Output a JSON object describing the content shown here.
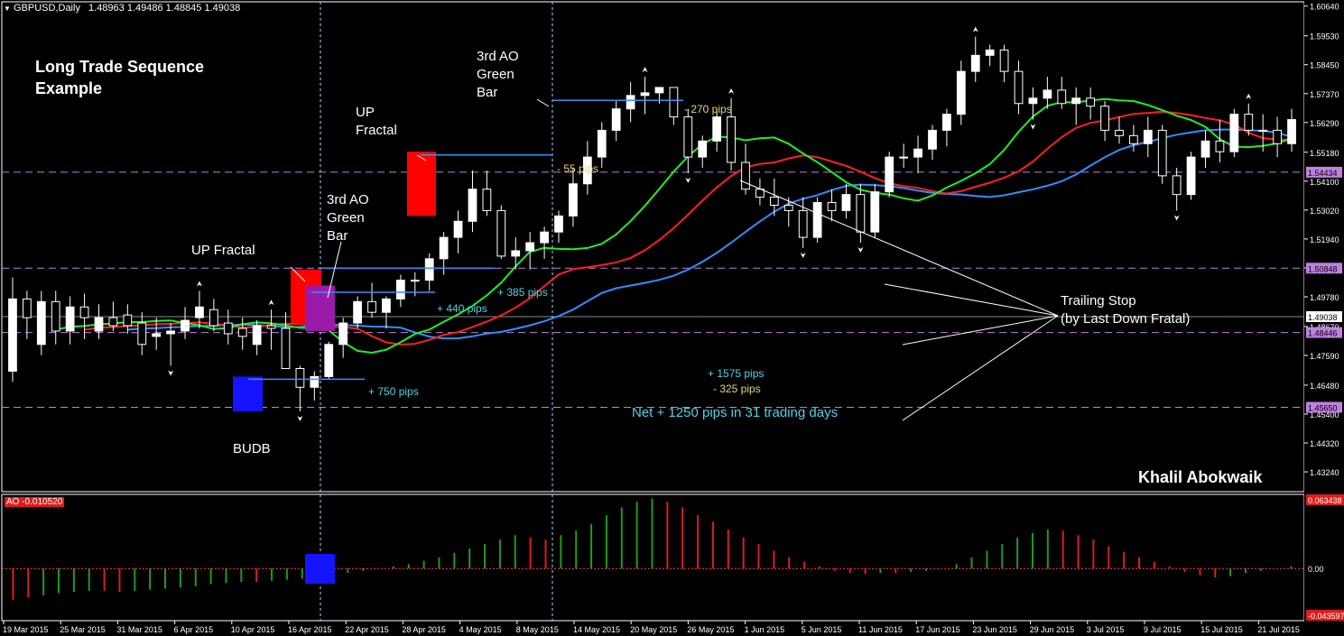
{
  "header": {
    "symbol": "GBPUSD,Daily",
    "ohlc": "1.48963 1.49486 1.48845 1.49038"
  },
  "annotations": {
    "title_line1": "Long Trade Sequence",
    "title_line2": "Example",
    "up_fractal_1": "UP Fractal",
    "ao_green_1_l1": "3rd AO",
    "ao_green_1_l2": "Green",
    "ao_green_1_l3": "Bar",
    "up_fractal_2_l1": "UP",
    "up_fractal_2_l2": "Fractal",
    "ao_green_2_l1": "3rd AO",
    "ao_green_2_l2": "Green",
    "ao_green_2_l3": "Bar",
    "budb": "BUDB",
    "trailing_l1": "Trailing Stop",
    "trailing_l2": "(by Last Down Fratal)",
    "gain_total": "+ 1575 pips",
    "loss_total": "- 325 pips",
    "net": "Net + 1250 pips in 31 trading days",
    "signature": "Khalil Abokwaik"
  },
  "trade_labels": [
    {
      "text": "+ 750 pips",
      "color": "#4fd3e6"
    },
    {
      "text": "+ 440 pips",
      "color": "#4fd3e6"
    },
    {
      "text": "+ 385 pips",
      "color": "#4fd3e6"
    },
    {
      "text": "- 55 pips",
      "color": "#e6d56b"
    },
    {
      "text": "- 270 pips",
      "color": "#e6d56b"
    }
  ],
  "price_axis": {
    "ticks": [
      "1.60640",
      "1.59530",
      "1.58450",
      "1.57370",
      "1.56290",
      "1.55180",
      "1.54100",
      "1.53020",
      "1.51940",
      "1.50860",
      "1.49780",
      "1.48670",
      "1.47590",
      "1.46480",
      "1.45400",
      "1.44320",
      "1.43240"
    ],
    "current_price": "1.49038",
    "hlines": [
      {
        "value": "1.54434",
        "color": "#c080e0"
      },
      {
        "value": "1.50848",
        "color": "#c080e0"
      },
      {
        "value": "1.48446",
        "color": "#c080e0"
      },
      {
        "value": "1.45650",
        "color": "#c080e0"
      }
    ]
  },
  "ao_panel": {
    "label": "AO -0.010520",
    "max_label": "0.063438",
    "zero_label": "0.00",
    "min_label": "-0.043597"
  },
  "date_axis": [
    "19 Mar 2015",
    "25 Mar 2015",
    "31 Mar 2015",
    "6 Apr 2015",
    "10 Apr 2015",
    "16 Apr 2015",
    "22 Apr 2015",
    "28 Apr 2015",
    "4 May 2015",
    "8 May 2015",
    "14 May 2015",
    "20 May 2015",
    "26 May 2015",
    "1 Jun 2015",
    "5 Jun 2015",
    "11 Jun 2015",
    "17 Jun 2015",
    "23 Jun 2015",
    "29 Jun 2015",
    "3 Jul 2015",
    "9 Jul 2015",
    "15 Jul 2015",
    "21 Jul 2015"
  ],
  "colors": {
    "background": "#000000",
    "bull_candle": "#ffffff",
    "bear_candle": "#000000",
    "jaw": "#2f8fff",
    "teeth": "#ff2020",
    "lips": "#22ee22",
    "ao_up": "#1f9a1f",
    "ao_down": "#e01b1b",
    "trade_line": "#3a8fff",
    "fractal_red": "#ff0000",
    "fractal_purple": "#9b1ba8",
    "budb_blue": "#1414ff"
  },
  "chart_data": {
    "type": "candlestick",
    "symbol": "GBPUSD",
    "timeframe": "Daily",
    "ylim": [
      1.425,
      1.608
    ],
    "candles": [
      [
        1.47,
        1.505,
        1.466,
        1.497
      ],
      [
        1.497,
        1.5,
        1.482,
        1.49
      ],
      [
        1.48,
        1.5,
        1.476,
        1.496
      ],
      [
        1.496,
        1.5,
        1.48,
        1.485
      ],
      [
        1.485,
        1.498,
        1.48,
        1.494
      ],
      [
        1.494,
        1.499,
        1.482,
        1.49
      ],
      [
        1.485,
        1.495,
        1.482,
        1.49
      ],
      [
        1.49,
        1.496,
        1.485,
        1.487
      ],
      [
        1.491,
        1.495,
        1.484,
        1.487
      ],
      [
        1.488,
        1.492,
        1.476,
        1.48
      ],
      [
        1.483,
        1.49,
        1.478,
        1.484
      ],
      [
        1.484,
        1.488,
        1.472,
        1.485
      ],
      [
        1.485,
        1.494,
        1.482,
        1.489
      ],
      [
        1.49,
        1.5,
        1.486,
        1.494
      ],
      [
        1.493,
        1.497,
        1.485,
        1.487
      ],
      [
        1.488,
        1.493,
        1.48,
        1.484
      ],
      [
        1.486,
        1.49,
        1.478,
        1.483
      ],
      [
        1.48,
        1.489,
        1.476,
        1.487
      ],
      [
        1.487,
        1.493,
        1.478,
        1.486
      ],
      [
        1.486,
        1.492,
        1.472,
        1.471
      ],
      [
        1.471,
        1.472,
        1.455,
        1.464
      ],
      [
        1.464,
        1.47,
        1.459,
        1.468
      ],
      [
        1.468,
        1.481,
        1.467,
        1.48
      ],
      [
        1.48,
        1.49,
        1.475,
        1.488
      ],
      [
        1.488,
        1.498,
        1.486,
        1.496
      ],
      [
        1.496,
        1.503,
        1.49,
        1.492
      ],
      [
        1.492,
        1.498,
        1.486,
        1.497
      ],
      [
        1.497,
        1.506,
        1.494,
        1.504
      ],
      [
        1.504,
        1.507,
        1.498,
        1.504
      ],
      [
        1.504,
        1.514,
        1.5,
        1.512
      ],
      [
        1.512,
        1.522,
        1.506,
        1.52
      ],
      [
        1.52,
        1.53,
        1.514,
        1.526
      ],
      [
        1.526,
        1.545,
        1.522,
        1.538
      ],
      [
        1.538,
        1.545,
        1.528,
        1.53
      ],
      [
        1.53,
        1.532,
        1.512,
        1.513
      ],
      [
        1.513,
        1.52,
        1.508,
        1.515
      ],
      [
        1.515,
        1.522,
        1.508,
        1.518
      ],
      [
        1.518,
        1.524,
        1.512,
        1.522
      ],
      [
        1.522,
        1.53,
        1.518,
        1.528
      ],
      [
        1.528,
        1.546,
        1.524,
        1.54
      ],
      [
        1.54,
        1.556,
        1.536,
        1.55
      ],
      [
        1.55,
        1.563,
        1.546,
        1.56
      ],
      [
        1.56,
        1.571,
        1.556,
        1.568
      ],
      [
        1.568,
        1.578,
        1.563,
        1.573
      ],
      [
        1.573,
        1.58,
        1.566,
        1.574
      ],
      [
        1.574,
        1.576,
        1.57,
        1.576
      ],
      [
        1.576,
        1.576,
        1.562,
        1.565
      ],
      [
        1.565,
        1.568,
        1.544,
        1.55
      ],
      [
        1.55,
        1.558,
        1.546,
        1.556
      ],
      [
        1.556,
        1.568,
        1.552,
        1.565
      ],
      [
        1.565,
        1.572,
        1.545,
        1.548
      ],
      [
        1.548,
        1.555,
        1.536,
        1.538
      ],
      [
        1.538,
        1.542,
        1.532,
        1.535
      ],
      [
        1.535,
        1.542,
        1.528,
        1.532
      ],
      [
        1.532,
        1.535,
        1.524,
        1.53
      ],
      [
        1.53,
        1.535,
        1.516,
        1.52
      ],
      [
        1.52,
        1.535,
        1.518,
        1.533
      ],
      [
        1.533,
        1.538,
        1.526,
        1.53
      ],
      [
        1.53,
        1.54,
        1.527,
        1.536
      ],
      [
        1.536,
        1.54,
        1.518,
        1.522
      ],
      [
        1.522,
        1.54,
        1.52,
        1.537
      ],
      [
        1.537,
        1.552,
        1.535,
        1.55
      ],
      [
        1.55,
        1.555,
        1.546,
        1.55
      ],
      [
        1.55,
        1.558,
        1.544,
        1.553
      ],
      [
        1.553,
        1.562,
        1.549,
        1.56
      ],
      [
        1.56,
        1.568,
        1.554,
        1.566
      ],
      [
        1.566,
        1.586,
        1.562,
        1.582
      ],
      [
        1.582,
        1.595,
        1.578,
        1.588
      ],
      [
        1.588,
        1.592,
        1.584,
        1.59
      ],
      [
        1.59,
        1.592,
        1.578,
        1.582
      ],
      [
        1.582,
        1.586,
        1.566,
        1.57
      ],
      [
        1.57,
        1.576,
        1.564,
        1.572
      ],
      [
        1.572,
        1.58,
        1.568,
        1.575
      ],
      [
        1.575,
        1.58,
        1.568,
        1.57
      ],
      [
        1.57,
        1.576,
        1.562,
        1.572
      ],
      [
        1.572,
        1.576,
        1.564,
        1.569
      ],
      [
        1.569,
        1.571,
        1.556,
        1.56
      ],
      [
        1.56,
        1.565,
        1.555,
        1.558
      ],
      [
        1.558,
        1.562,
        1.552,
        1.555
      ],
      [
        1.555,
        1.565,
        1.55,
        1.56
      ],
      [
        1.56,
        1.562,
        1.54,
        1.543
      ],
      [
        1.543,
        1.546,
        1.53,
        1.536
      ],
      [
        1.536,
        1.552,
        1.534,
        1.55
      ],
      [
        1.55,
        1.56,
        1.546,
        1.556
      ],
      [
        1.556,
        1.564,
        1.548,
        1.552
      ],
      [
        1.552,
        1.568,
        1.55,
        1.566
      ],
      [
        1.566,
        1.57,
        1.558,
        1.56
      ],
      [
        1.56,
        1.566,
        1.552,
        1.56
      ],
      [
        1.56,
        1.565,
        1.55,
        1.555
      ],
      [
        1.555,
        1.568,
        1.552,
        1.564
      ]
    ],
    "alligator": {
      "jaw_color": "blue",
      "teeth_color": "red",
      "lips_color": "green"
    },
    "ao_bars": [
      [
        -0.028,
        0
      ],
      [
        -0.026,
        0
      ],
      [
        -0.024,
        1
      ],
      [
        -0.022,
        1
      ],
      [
        -0.021,
        1
      ],
      [
        -0.02,
        1
      ],
      [
        -0.02,
        0
      ],
      [
        -0.021,
        0
      ],
      [
        -0.02,
        1
      ],
      [
        -0.019,
        1
      ],
      [
        -0.018,
        1
      ],
      [
        -0.017,
        1
      ],
      [
        -0.016,
        1
      ],
      [
        -0.014,
        1
      ],
      [
        -0.013,
        1
      ],
      [
        -0.012,
        1
      ],
      [
        -0.012,
        0
      ],
      [
        -0.011,
        1
      ],
      [
        -0.01,
        1
      ],
      [
        -0.009,
        1
      ],
      [
        -0.008,
        1
      ],
      [
        -0.006,
        1
      ],
      [
        -0.004,
        1
      ],
      [
        -0.002,
        1
      ],
      [
        0.0,
        1
      ],
      [
        0.002,
        1
      ],
      [
        0.004,
        1
      ],
      [
        0.007,
        1
      ],
      [
        0.01,
        1
      ],
      [
        0.014,
        1
      ],
      [
        0.018,
        1
      ],
      [
        0.022,
        1
      ],
      [
        0.026,
        1
      ],
      [
        0.03,
        1
      ],
      [
        0.028,
        0
      ],
      [
        0.026,
        0
      ],
      [
        0.03,
        1
      ],
      [
        0.034,
        1
      ],
      [
        0.04,
        1
      ],
      [
        0.048,
        1
      ],
      [
        0.055,
        1
      ],
      [
        0.06,
        1
      ],
      [
        0.063,
        1
      ],
      [
        0.06,
        0
      ],
      [
        0.055,
        0
      ],
      [
        0.048,
        0
      ],
      [
        0.042,
        0
      ],
      [
        0.035,
        0
      ],
      [
        0.028,
        0
      ],
      [
        0.022,
        0
      ],
      [
        0.016,
        0
      ],
      [
        0.01,
        0
      ],
      [
        0.006,
        0
      ],
      [
        0.002,
        0
      ],
      [
        -0.002,
        0
      ],
      [
        -0.004,
        0
      ],
      [
        -0.005,
        0
      ],
      [
        -0.004,
        1
      ],
      [
        -0.004,
        0
      ],
      [
        -0.003,
        1
      ],
      [
        -0.002,
        1
      ],
      [
        0.0,
        1
      ],
      [
        0.004,
        1
      ],
      [
        0.01,
        1
      ],
      [
        0.016,
        1
      ],
      [
        0.022,
        1
      ],
      [
        0.028,
        1
      ],
      [
        0.032,
        1
      ],
      [
        0.035,
        1
      ],
      [
        0.034,
        0
      ],
      [
        0.03,
        0
      ],
      [
        0.026,
        0
      ],
      [
        0.02,
        0
      ],
      [
        0.015,
        0
      ],
      [
        0.01,
        0
      ],
      [
        0.006,
        0
      ],
      [
        0.002,
        0
      ],
      [
        -0.003,
        0
      ],
      [
        -0.006,
        0
      ],
      [
        -0.008,
        0
      ],
      [
        -0.007,
        1
      ],
      [
        -0.004,
        1
      ],
      [
        -0.002,
        1
      ],
      [
        0.0,
        1
      ],
      [
        0.002,
        1
      ]
    ]
  }
}
